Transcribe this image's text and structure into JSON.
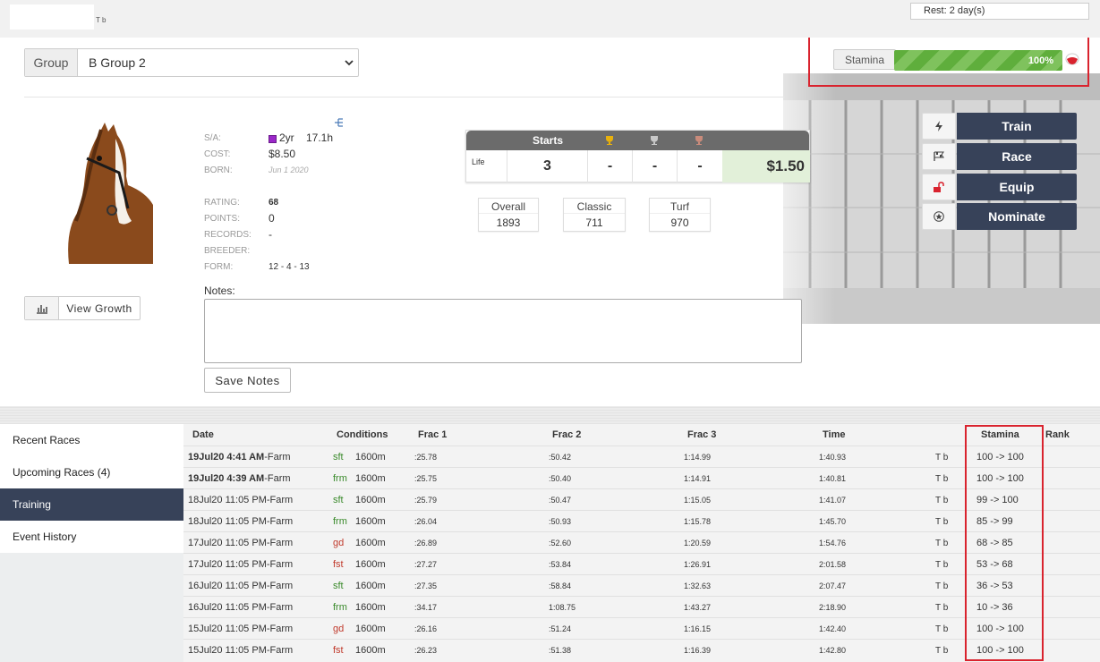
{
  "topbar": {
    "tb_tag": "T b",
    "rest": "Rest: 2 day(s)"
  },
  "group": {
    "label": "Group",
    "value": "B Group 2"
  },
  "stamina": {
    "label": "Stamina",
    "percent": 100,
    "percent_text": "100%"
  },
  "horse": {
    "sa_label": "S/A:",
    "age": "2yr",
    "height": "17.1h",
    "cost_label": "COST:",
    "cost": "$8.50",
    "born_label": "BORN:",
    "born": "Jun 1 2020",
    "rating_label": "RATING:",
    "rating": "68",
    "points_label": "POINTS:",
    "points": "0",
    "records_label": "RECORDS:",
    "records": "-",
    "breeder_label": "BREEDER:",
    "breeder": "",
    "form_label": "FORM:",
    "form": "12 - 4 - 13"
  },
  "view_growth": "View Growth",
  "stats": {
    "starts_label": "Starts",
    "life_label": "Life",
    "starts": "3",
    "first": "-",
    "second": "-",
    "third": "-",
    "earnings": "$1.50"
  },
  "ratings": [
    {
      "label": "Overall",
      "value": "1893"
    },
    {
      "label": "Classic",
      "value": "711"
    },
    {
      "label": "Turf",
      "value": "970"
    }
  ],
  "notes": {
    "label": "Notes:",
    "value": "",
    "save": "Save Notes"
  },
  "actions": [
    "Train",
    "Race",
    "Equip",
    "Nominate"
  ],
  "tabs": [
    "Recent Races",
    "Upcoming Races (4)",
    "Training",
    "Event History"
  ],
  "active_tab": "Training",
  "table": {
    "headers": [
      "Date",
      "Conditions",
      "Frac 1",
      "Frac 2",
      "Frac 3",
      "Time",
      "Stamina",
      "Rank"
    ],
    "rows": [
      {
        "date_bold": "19Jul20 4:41 AM",
        "date_rest": "-Farm",
        "cond": "sft",
        "dist": "1600m",
        "f1": ":25.78",
        "f2": ":50.42",
        "f3": "1:14.99",
        "time": "1:40.93",
        "tb": "T b",
        "stamina": "100 -> 100"
      },
      {
        "date_bold": "19Jul20 4:39 AM",
        "date_rest": "-Farm",
        "cond": "frm",
        "dist": "1600m",
        "f1": ":25.75",
        "f2": ":50.40",
        "f3": "1:14.91",
        "time": "1:40.81",
        "tb": "T b",
        "stamina": "100 -> 100"
      },
      {
        "date_bold": "",
        "date_rest": "18Jul20 11:05 PM-Farm",
        "cond": "sft",
        "dist": "1600m",
        "f1": ":25.79",
        "f2": ":50.47",
        "f3": "1:15.05",
        "time": "1:41.07",
        "tb": "T b",
        "stamina": "99 -> 100"
      },
      {
        "date_bold": "",
        "date_rest": "18Jul20 11:05 PM-Farm",
        "cond": "frm",
        "dist": "1600m",
        "f1": ":26.04",
        "f2": ":50.93",
        "f3": "1:15.78",
        "time": "1:45.70",
        "tb": "T b",
        "stamina": "85 -> 99"
      },
      {
        "date_bold": "",
        "date_rest": "17Jul20 11:05 PM-Farm",
        "cond": "gd",
        "dist": "1600m",
        "f1": ":26.89",
        "f2": ":52.60",
        "f3": "1:20.59",
        "time": "1:54.76",
        "tb": "T b",
        "stamina": "68 -> 85"
      },
      {
        "date_bold": "",
        "date_rest": "17Jul20 11:05 PM-Farm",
        "cond": "fst",
        "dist": "1600m",
        "f1": ":27.27",
        "f2": ":53.84",
        "f3": "1:26.91",
        "time": "2:01.58",
        "tb": "T b",
        "stamina": "53 -> 68"
      },
      {
        "date_bold": "",
        "date_rest": "16Jul20 11:05 PM-Farm",
        "cond": "sft",
        "dist": "1600m",
        "f1": ":27.35",
        "f2": ":58.84",
        "f3": "1:32.63",
        "time": "2:07.47",
        "tb": "T b",
        "stamina": "36 -> 53"
      },
      {
        "date_bold": "",
        "date_rest": "16Jul20 11:05 PM-Farm",
        "cond": "frm",
        "dist": "1600m",
        "f1": ":34.17",
        "f2": "1:08.75",
        "f3": "1:43.27",
        "time": "2:18.90",
        "tb": "T b",
        "stamina": "10 -> 36"
      },
      {
        "date_bold": "",
        "date_rest": "15Jul20 11:05 PM-Farm",
        "cond": "gd",
        "dist": "1600m",
        "f1": ":26.16",
        "f2": ":51.24",
        "f3": "1:16.15",
        "time": "1:42.40",
        "tb": "T b",
        "stamina": "100 -> 100"
      },
      {
        "date_bold": "",
        "date_rest": "15Jul20 11:05 PM-Farm",
        "cond": "fst",
        "dist": "1600m",
        "f1": ":26.23",
        "f2": ":51.38",
        "f3": "1:16.39",
        "time": "1:42.80",
        "tb": "T b",
        "stamina": "100 -> 100"
      }
    ]
  },
  "colors": {
    "accent": "#374259",
    "highlight_box": "#d9232e",
    "stamina_fill": "#5fae3c",
    "cond_sft": "#3a8a2b",
    "cond_frm": "#3a8a2b",
    "cond_gd": "#c0392b",
    "cond_fst": "#c0392b",
    "earnings_bg": "#e2f0d9"
  },
  "icons": {
    "train": "lightning-icon",
    "race": "checkered-flag-icon",
    "equip": "unlocked-padlock-icon",
    "nominate": "star-badge-icon",
    "growth": "bar-chart-icon",
    "age": "purple-square-icon"
  }
}
